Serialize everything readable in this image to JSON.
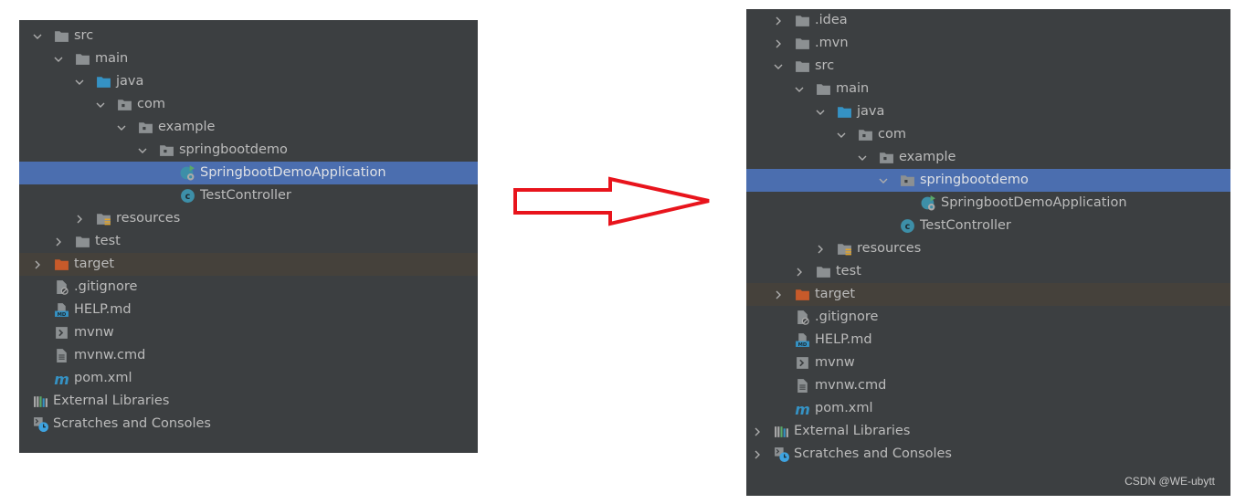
{
  "left_tree": {
    "rows": [
      {
        "label": "src",
        "level": 1,
        "chevron": "down",
        "icon": "folder-icon"
      },
      {
        "label": "main",
        "level": 2,
        "chevron": "down",
        "icon": "folder-icon"
      },
      {
        "label": "java",
        "level": 3,
        "chevron": "down",
        "icon": "source-folder-icon"
      },
      {
        "label": "com",
        "level": 4,
        "chevron": "down",
        "icon": "package-icon"
      },
      {
        "label": "example",
        "level": 5,
        "chevron": "down",
        "icon": "package-icon"
      },
      {
        "label": "springbootdemo",
        "level": 6,
        "chevron": "down",
        "icon": "package-icon"
      },
      {
        "label": "SpringbootDemoApplication",
        "level": 7,
        "chevron": "none",
        "icon": "spring-boot-class-icon",
        "selected": true
      },
      {
        "label": "TestController",
        "level": 7,
        "chevron": "none",
        "icon": "class-icon"
      },
      {
        "label": "resources",
        "level": 3,
        "chevron": "right",
        "icon": "resources-folder-icon"
      },
      {
        "label": "test",
        "level": 2,
        "chevron": "right",
        "icon": "folder-icon"
      },
      {
        "label": "target",
        "level": 1,
        "chevron": "right",
        "icon": "excluded-folder-icon",
        "excluded": true
      },
      {
        "label": ".gitignore",
        "level": 1,
        "chevron": "none",
        "icon": "gitignore-file-icon"
      },
      {
        "label": "HELP.md",
        "level": 1,
        "chevron": "none",
        "icon": "markdown-file-icon"
      },
      {
        "label": "mvnw",
        "level": 1,
        "chevron": "none",
        "icon": "shell-script-icon"
      },
      {
        "label": "mvnw.cmd",
        "level": 1,
        "chevron": "none",
        "icon": "text-file-icon"
      },
      {
        "label": "pom.xml",
        "level": 1,
        "chevron": "none",
        "icon": "maven-icon"
      },
      {
        "label": "External Libraries",
        "level": 0,
        "chevron": "none",
        "icon": "libraries-icon"
      },
      {
        "label": "Scratches and Consoles",
        "level": 0,
        "chevron": "none",
        "icon": "scratches-icon"
      }
    ]
  },
  "right_tree": {
    "rows": [
      {
        "label": ".idea",
        "level": 1,
        "chevron": "right",
        "icon": "folder-icon"
      },
      {
        "label": ".mvn",
        "level": 1,
        "chevron": "right",
        "icon": "folder-icon"
      },
      {
        "label": "src",
        "level": 1,
        "chevron": "down",
        "icon": "folder-icon"
      },
      {
        "label": "main",
        "level": 2,
        "chevron": "down",
        "icon": "folder-icon"
      },
      {
        "label": "java",
        "level": 3,
        "chevron": "down",
        "icon": "source-folder-icon"
      },
      {
        "label": "com",
        "level": 4,
        "chevron": "down",
        "icon": "package-icon"
      },
      {
        "label": "example",
        "level": 5,
        "chevron": "down",
        "icon": "package-icon"
      },
      {
        "label": "springbootdemo",
        "level": 6,
        "chevron": "down",
        "icon": "package-icon",
        "selected": true
      },
      {
        "label": "SpringbootDemoApplication",
        "level": 7,
        "chevron": "none",
        "icon": "spring-boot-class-icon"
      },
      {
        "label": "TestController",
        "level": 6,
        "chevron": "none",
        "icon": "class-icon"
      },
      {
        "label": "resources",
        "level": 3,
        "chevron": "right",
        "icon": "resources-folder-icon"
      },
      {
        "label": "test",
        "level": 2,
        "chevron": "right",
        "icon": "folder-icon"
      },
      {
        "label": "target",
        "level": 1,
        "chevron": "right",
        "icon": "excluded-folder-icon",
        "excluded": true
      },
      {
        "label": ".gitignore",
        "level": 1,
        "chevron": "none",
        "icon": "gitignore-file-icon"
      },
      {
        "label": "HELP.md",
        "level": 1,
        "chevron": "none",
        "icon": "markdown-file-icon"
      },
      {
        "label": "mvnw",
        "level": 1,
        "chevron": "none",
        "icon": "shell-script-icon"
      },
      {
        "label": "mvnw.cmd",
        "level": 1,
        "chevron": "none",
        "icon": "text-file-icon"
      },
      {
        "label": "pom.xml",
        "level": 1,
        "chevron": "none",
        "icon": "maven-icon"
      },
      {
        "label": "External Libraries",
        "level": 0,
        "chevron": "right",
        "icon": "libraries-icon"
      },
      {
        "label": "Scratches and Consoles",
        "level": 0,
        "chevron": "right",
        "icon": "scratches-icon"
      }
    ]
  },
  "watermark": "CSDN @WE-ubytt",
  "colors": {
    "panel_bg": "#3c3f41",
    "selection": "#4b6eaf",
    "excluded_row": "#45413b",
    "arrow": "#e8141c",
    "text": "#bbbbbb"
  }
}
